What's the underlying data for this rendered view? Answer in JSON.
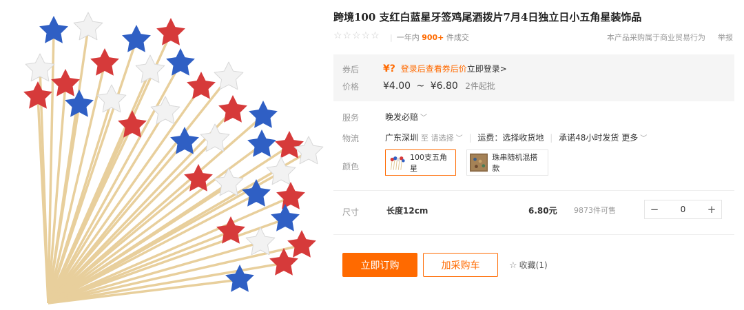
{
  "product": {
    "title": "跨境100 支红白蓝星牙签鸡尾酒拨片7月4日独立日小五角星装饰品"
  },
  "rating": {
    "stars_icon": "☆☆☆☆☆",
    "sales_prefix": "一年内",
    "sales_count": "900+",
    "sales_suffix": "件成交",
    "business_note": "本产品采购属于商业贸易行为",
    "report_label": "举报"
  },
  "price_box": {
    "coupon_label": "券后",
    "price_label": "价格",
    "coupon_symbol": "¥?",
    "coupon_hint": "登录后查看券后价",
    "login_link": "立即登录>",
    "price_min": "¥4.00",
    "price_tilde": "~",
    "price_max": "¥6.80",
    "moq": "2件起批"
  },
  "attributes": {
    "service_label": "服务",
    "service_value": "晚发必赔",
    "logistics_label": "物流",
    "origin": "广东深圳",
    "to_prefix": "至",
    "destination_placeholder": "请选择",
    "freight": "运费：选择收货地",
    "promise": "承诺48小时发货",
    "more_label": "更多",
    "color_label": "颜色",
    "colors": [
      {
        "label": "100支五角星",
        "selected": true
      },
      {
        "label": "珠串随机混搭款",
        "selected": false
      }
    ]
  },
  "size": {
    "label": "尺寸",
    "name": "长度12cm",
    "price": "6.80元",
    "stock": "9873件可售",
    "minus": "−",
    "quantity": "0",
    "plus": "+"
  },
  "actions": {
    "order_label": "立即订购",
    "cart_label": "加采购车",
    "favorite_label": "收藏(1)"
  },
  "colors": {
    "accent": "#ff6a00",
    "star_red": "#d63a3a",
    "star_blue": "#2f5fc4",
    "star_white": "#f2f2f2",
    "stick": "#e8cf9c"
  }
}
